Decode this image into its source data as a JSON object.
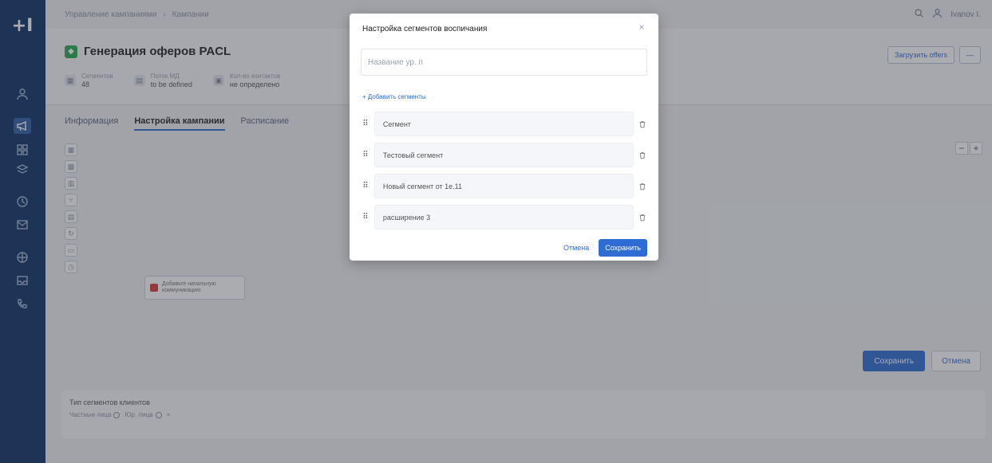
{
  "nav": {
    "logo": "+I",
    "items": [
      {
        "icon": "user-icon"
      },
      {
        "icon": "megaphone-icon",
        "active": true
      },
      {
        "icon": "grid-icon"
      },
      {
        "icon": "layers-icon"
      },
      {
        "icon": "clock-icon"
      },
      {
        "icon": "mail-icon"
      },
      {
        "icon": "globe-icon"
      },
      {
        "icon": "inbox-icon"
      },
      {
        "icon": "phone-icon"
      }
    ]
  },
  "topbar": {
    "breadcrumb_1": "Управление кампаниями",
    "breadcrumb_sep": "›",
    "breadcrumb_2": "Кампании",
    "user_name": "Ivanov I."
  },
  "header": {
    "title": "Генерация оферов PACL",
    "meta": [
      {
        "label": "Сегментов",
        "value": "48"
      },
      {
        "label": "Поток МД",
        "value": "to be defined"
      },
      {
        "label": "Кол-во контактов",
        "value": "не определено"
      }
    ],
    "action_label": "Загрузить offers",
    "more_label": "—"
  },
  "tabs": [
    {
      "label": "Информация",
      "active": false
    },
    {
      "label": "Настройка кампании",
      "active": true
    },
    {
      "label": "Расписание",
      "active": false
    }
  ],
  "canvas": {
    "zoom_out": "−",
    "zoom_in": "+",
    "node_text": "Добавьте начальную коммуникацию",
    "save_label": "Сохранить",
    "cancel_label": "Отмена"
  },
  "segment_panel": {
    "title": "Тип сегментов клиентов",
    "chips": [
      "Частные лица",
      "Юр. лица",
      "×"
    ]
  },
  "modal": {
    "title": "Настройка сегментов воспичания",
    "close": "×",
    "name_placeholder": "Название ур. п",
    "add_label": "+ Добавить сегменты",
    "segments": [
      "Сегмент",
      "Тестовый сегмент",
      "Новый сегмент от 1е.11",
      "расширение 3"
    ],
    "cancel_label": "Отмена",
    "save_label": "Сохранить"
  },
  "colors": {
    "rail": "#0d3166",
    "accent": "#2e6bd2",
    "brand_green": "#27a74a",
    "node_red": "#d33a3a"
  }
}
